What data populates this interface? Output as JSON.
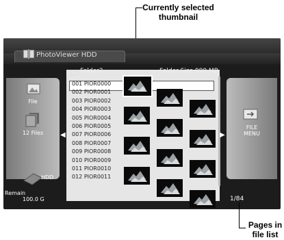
{
  "callouts": {
    "top_line1": "Currently selected",
    "top_line2": "thumbnail",
    "bottom_line1": "Pages in",
    "bottom_line2": "file list"
  },
  "app": {
    "title": "PhotoViewer HDD"
  },
  "folder": {
    "name": "Folder2",
    "size_label": "Folder Size 999 MB"
  },
  "left_panel": {
    "file_label": "File",
    "count_label": "12 Files",
    "drive_label": "HDD",
    "remain_label": "Remain",
    "remain_value": "100.0 G"
  },
  "right_panel": {
    "menu_line1": "FILE",
    "menu_line2": "MENU"
  },
  "page_indicator": "1/84",
  "files": [
    "001  PIOR0000",
    "002  PIOR0001",
    "003  PIOR0002",
    "004  PIOR0003",
    "005  PIOR0004",
    "006  PIOR0005",
    "007  PIOR0006",
    "008  PIOR0007",
    "009  PIOR0008",
    "010  PIOR0009",
    "011  PIOR0010",
    "012  PIOR0011"
  ],
  "selected_index": 0,
  "colors": {
    "screen_bg": "#1c1c1c",
    "list_bg": "#e6e6e6",
    "panel_gray": "#a0a0a0"
  }
}
